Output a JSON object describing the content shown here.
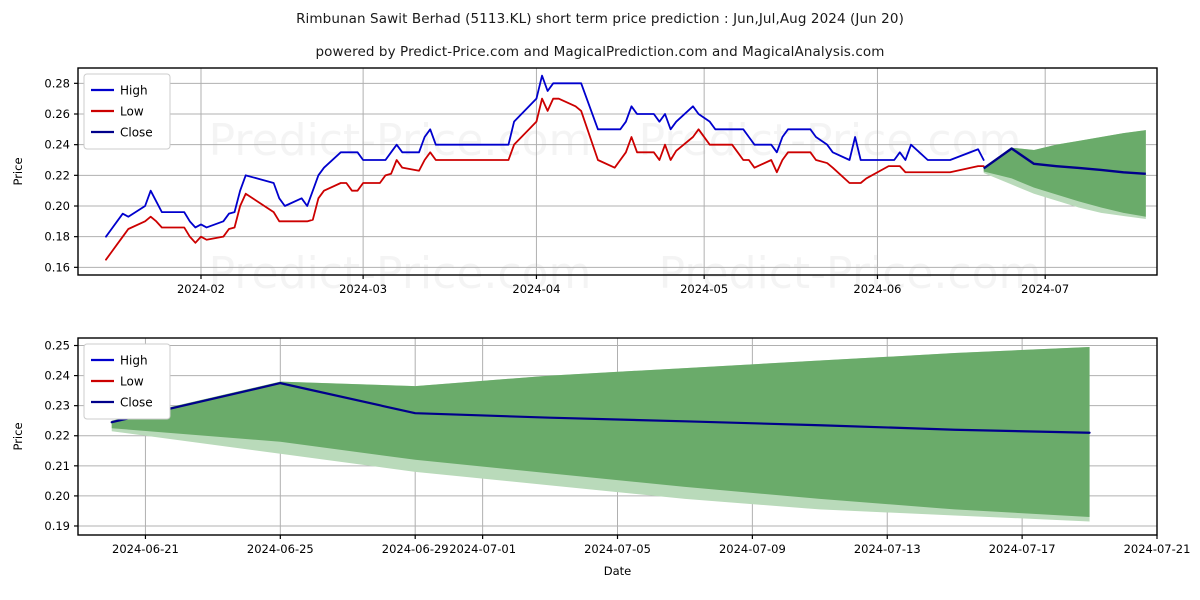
{
  "header": {
    "title": "Rimbunan Sawit Berhad (5113.KL) short term price prediction : Jun,Jul,Aug 2024 (Jun 20)",
    "subtitle": "powered by Predict-Price.com and MagicalPrediction.com and MagicalAnalysis.com"
  },
  "watermark": {
    "text": "Predict-Price.com"
  },
  "colors": {
    "high": "#0000cd",
    "low": "#cc0000",
    "close": "#00008b",
    "band": "#6aab6a",
    "band_light": "#b9daba",
    "grid": "#b0b0b0",
    "axis": "#000000",
    "background": "#ffffff"
  },
  "legend": {
    "items": [
      {
        "label": "High",
        "color": "#0000cd"
      },
      {
        "label": "Low",
        "color": "#cc0000"
      },
      {
        "label": "Close",
        "color": "#00008b"
      }
    ]
  },
  "chart_data": [
    {
      "id": "history-chart",
      "type": "line",
      "title": "",
      "xlabel": "Date",
      "ylabel": "Price",
      "grid": true,
      "legend_position": "upper left",
      "ylim": [
        0.155,
        0.29
      ],
      "yticks": [
        0.16,
        0.18,
        0.2,
        0.22,
        0.24,
        0.26,
        0.28
      ],
      "ytick_labels": [
        "0.16",
        "0.18",
        "0.20",
        "0.22",
        "0.24",
        "0.26",
        "0.28"
      ],
      "xlim": [
        "2024-01-10",
        "2024-07-21"
      ],
      "xticks": [
        "2024-02-01",
        "2024-03-01",
        "2024-04-01",
        "2024-05-01",
        "2024-06-01",
        "2024-07-01"
      ],
      "xtick_labels": [
        "2024-02",
        "2024-03",
        "2024-04",
        "2024-05",
        "2024-06",
        "2024-07"
      ],
      "x": [
        "2024-01-15",
        "2024-01-16",
        "2024-01-17",
        "2024-01-18",
        "2024-01-19",
        "2024-01-22",
        "2024-01-23",
        "2024-01-24",
        "2024-01-25",
        "2024-01-26",
        "2024-01-29",
        "2024-01-30",
        "2024-01-31",
        "2024-02-01",
        "2024-02-02",
        "2024-02-05",
        "2024-02-06",
        "2024-02-07",
        "2024-02-08",
        "2024-02-09",
        "2024-02-14",
        "2024-02-15",
        "2024-02-16",
        "2024-02-19",
        "2024-02-20",
        "2024-02-21",
        "2024-02-22",
        "2024-02-23",
        "2024-02-26",
        "2024-02-27",
        "2024-02-28",
        "2024-02-29",
        "2024-03-01",
        "2024-03-04",
        "2024-03-05",
        "2024-03-06",
        "2024-03-07",
        "2024-03-08",
        "2024-03-11",
        "2024-03-12",
        "2024-03-13",
        "2024-03-14",
        "2024-03-15",
        "2024-03-18",
        "2024-03-19",
        "2024-03-20",
        "2024-03-21",
        "2024-03-22",
        "2024-03-25",
        "2024-03-26",
        "2024-03-27",
        "2024-03-28",
        "2024-04-01",
        "2024-04-02",
        "2024-04-03",
        "2024-04-04",
        "2024-04-05",
        "2024-04-08",
        "2024-04-09",
        "2024-04-12",
        "2024-04-15",
        "2024-04-16",
        "2024-04-17",
        "2024-04-18",
        "2024-04-19",
        "2024-04-22",
        "2024-04-23",
        "2024-04-24",
        "2024-04-25",
        "2024-04-26",
        "2024-04-29",
        "2024-04-30",
        "2024-05-02",
        "2024-05-03",
        "2024-05-06",
        "2024-05-07",
        "2024-05-08",
        "2024-05-09",
        "2024-05-10",
        "2024-05-13",
        "2024-05-14",
        "2024-05-15",
        "2024-05-16",
        "2024-05-17",
        "2024-05-20",
        "2024-05-21",
        "2024-05-23",
        "2024-05-24",
        "2024-05-27",
        "2024-05-28",
        "2024-05-29",
        "2024-05-30",
        "2024-06-03",
        "2024-06-04",
        "2024-06-05",
        "2024-06-06",
        "2024-06-07",
        "2024-06-10",
        "2024-06-11",
        "2024-06-12",
        "2024-06-13",
        "2024-06-14",
        "2024-06-19",
        "2024-06-20"
      ],
      "series": [
        {
          "name": "High",
          "color": "#0000cd",
          "values": [
            0.18,
            0.185,
            0.19,
            0.195,
            0.193,
            0.2,
            0.21,
            0.203,
            0.196,
            0.196,
            0.196,
            0.19,
            0.186,
            0.188,
            0.186,
            0.19,
            0.195,
            0.196,
            0.21,
            0.22,
            0.215,
            0.205,
            0.2,
            0.205,
            0.2,
            0.21,
            0.22,
            0.225,
            0.235,
            0.235,
            0.235,
            0.235,
            0.23,
            0.23,
            0.23,
            0.235,
            0.24,
            0.235,
            0.235,
            0.245,
            0.25,
            0.24,
            0.24,
            0.24,
            0.24,
            0.24,
            0.24,
            0.24,
            0.24,
            0.24,
            0.24,
            0.255,
            0.27,
            0.285,
            0.275,
            0.28,
            0.28,
            0.28,
            0.28,
            0.25,
            0.25,
            0.25,
            0.255,
            0.265,
            0.26,
            0.26,
            0.255,
            0.26,
            0.25,
            0.255,
            0.265,
            0.26,
            0.255,
            0.25,
            0.25,
            0.25,
            0.25,
            0.245,
            0.24,
            0.24,
            0.235,
            0.245,
            0.25,
            0.25,
            0.25,
            0.245,
            0.24,
            0.235,
            0.23,
            0.245,
            0.23,
            0.23,
            0.23,
            0.23,
            0.235,
            0.23,
            0.24,
            0.23,
            0.23,
            0.23,
            0.23,
            0.23,
            0.237,
            0.23
          ]
        },
        {
          "name": "Low",
          "color": "#cc0000",
          "values": [
            0.165,
            0.17,
            0.175,
            0.18,
            0.185,
            0.19,
            0.193,
            0.19,
            0.186,
            0.186,
            0.186,
            0.18,
            0.176,
            0.18,
            0.178,
            0.18,
            0.185,
            0.186,
            0.2,
            0.208,
            0.196,
            0.19,
            0.19,
            0.19,
            0.19,
            0.191,
            0.205,
            0.21,
            0.215,
            0.215,
            0.21,
            0.21,
            0.215,
            0.215,
            0.22,
            0.221,
            0.23,
            0.225,
            0.223,
            0.23,
            0.235,
            0.23,
            0.23,
            0.23,
            0.23,
            0.23,
            0.23,
            0.23,
            0.23,
            0.23,
            0.23,
            0.24,
            0.255,
            0.27,
            0.262,
            0.27,
            0.27,
            0.265,
            0.262,
            0.23,
            0.225,
            0.23,
            0.235,
            0.245,
            0.235,
            0.235,
            0.23,
            0.24,
            0.23,
            0.236,
            0.245,
            0.25,
            0.24,
            0.24,
            0.24,
            0.235,
            0.23,
            0.23,
            0.225,
            0.23,
            0.222,
            0.23,
            0.235,
            0.235,
            0.235,
            0.23,
            0.228,
            0.225,
            0.215,
            0.215,
            0.215,
            0.218,
            0.226,
            0.226,
            0.226,
            0.222,
            0.222,
            0.222,
            0.222,
            0.222,
            0.222,
            0.222,
            0.226,
            0.226
          ]
        }
      ],
      "forecast": {
        "name": "Close",
        "color": "#00008b",
        "x": [
          "2024-06-20",
          "2024-06-25",
          "2024-06-29",
          "2024-07-03",
          "2024-07-07",
          "2024-07-11",
          "2024-07-15",
          "2024-07-19"
        ],
        "values": [
          0.2245,
          0.2375,
          0.2275,
          0.226,
          0.2248,
          0.2235,
          0.222,
          0.221
        ],
        "band_upper": [
          0.225,
          0.238,
          0.2365,
          0.24,
          0.2425,
          0.245,
          0.2475,
          0.2495
        ],
        "band_lower": [
          0.2225,
          0.218,
          0.212,
          0.2075,
          0.203,
          0.199,
          0.1955,
          0.193
        ],
        "band_light_lower": [
          0.2215,
          0.214,
          0.208,
          0.2035,
          0.199,
          0.1955,
          0.1935,
          0.1915
        ]
      }
    },
    {
      "id": "forecast-chart",
      "type": "line",
      "title": "",
      "xlabel": "Date",
      "ylabel": "Price",
      "grid": true,
      "legend_position": "upper left",
      "ylim": [
        0.187,
        0.2525
      ],
      "yticks": [
        0.19,
        0.2,
        0.21,
        0.22,
        0.23,
        0.24,
        0.25
      ],
      "ytick_labels": [
        "0.19",
        "0.20",
        "0.21",
        "0.22",
        "0.23",
        "0.24",
        "0.25"
      ],
      "xlim": [
        "2024-06-19",
        "2024-07-21"
      ],
      "xticks": [
        "2024-06-21",
        "2024-06-25",
        "2024-06-29",
        "2024-07-01",
        "2024-07-05",
        "2024-07-09",
        "2024-07-13",
        "2024-07-17",
        "2024-07-21"
      ],
      "xtick_labels": [
        "2024-06-21",
        "2024-06-25",
        "2024-06-29",
        "2024-07-01",
        "2024-07-05",
        "2024-07-09",
        "2024-07-13",
        "2024-07-17",
        "2024-07-21"
      ],
      "x": [
        "2024-06-20",
        "2024-06-25",
        "2024-06-29",
        "2024-07-03",
        "2024-07-07",
        "2024-07-11",
        "2024-07-15",
        "2024-07-19"
      ],
      "series": [
        {
          "name": "Close",
          "color": "#00008b",
          "values": [
            0.2245,
            0.2375,
            0.2275,
            0.226,
            0.2248,
            0.2235,
            0.222,
            0.221
          ]
        }
      ],
      "band_upper": [
        0.225,
        0.238,
        0.2365,
        0.24,
        0.2425,
        0.245,
        0.2475,
        0.2495
      ],
      "band_lower": [
        0.2225,
        0.218,
        0.212,
        0.2075,
        0.203,
        0.199,
        0.1955,
        0.193
      ],
      "band_light_lower": [
        0.2215,
        0.214,
        0.208,
        0.2035,
        0.199,
        0.1955,
        0.1935,
        0.1915
      ]
    }
  ]
}
